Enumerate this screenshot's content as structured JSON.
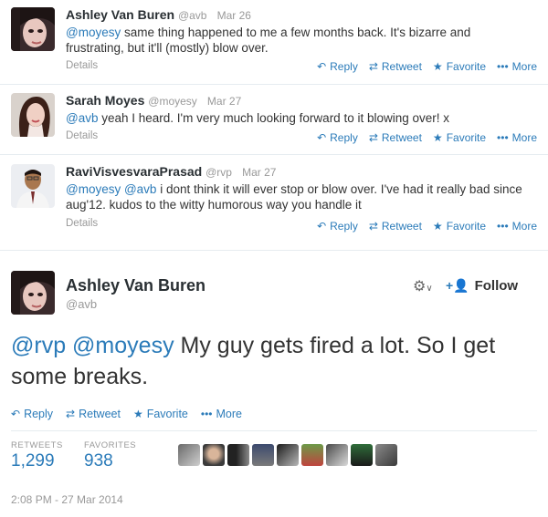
{
  "replies": [
    {
      "name": "Ashley Van Buren",
      "handle": "@avb",
      "date": "Mar 26",
      "mentions": "@moyesy",
      "text": "same thing happened to me a few months back. It's bizarre and frustrating, but it'll (mostly) blow over.",
      "details": "Details"
    },
    {
      "name": "Sarah Moyes",
      "handle": "@moyesy",
      "date": "Mar 27",
      "mentions": "@avb",
      "text": "yeah I heard. I'm very much looking forward to it blowing over! x",
      "details": "Details"
    },
    {
      "name": "RaviVisvesvaraPrasad",
      "handle": "@rvp",
      "date": "Mar 27",
      "mentions": "@moyesy @avb",
      "text": "i dont think it will ever stop or blow over. I've had it really bad since aug'12. kudos to the witty humorous way you handle it",
      "details": "Details"
    }
  ],
  "actions": {
    "reply": "Reply",
    "retweet": "Retweet",
    "favorite": "Favorite",
    "more": "More"
  },
  "icons": {
    "reply": "reply-arrow-icon",
    "retweet": "retweet-icon",
    "favorite": "star-icon",
    "more": "ellipsis-icon",
    "settings": "gear-icon",
    "follow": "add-user-icon"
  },
  "main_tweet": {
    "name": "Ashley Van Buren",
    "handle": "@avb",
    "mentions": "@rvp @moyesy",
    "text": "My guy gets fired a lot. So I get some breaks.",
    "follow_label": "Follow",
    "retweets_label": "RETWEETS",
    "retweets_count": "1,299",
    "favorites_label": "FAVORITES",
    "favorites_count": "938",
    "timestamp": "2:08 PM - 27 Mar 2014"
  },
  "colors": {
    "link": "#2b7bb9",
    "muted": "#999999",
    "name": "#292f33"
  }
}
